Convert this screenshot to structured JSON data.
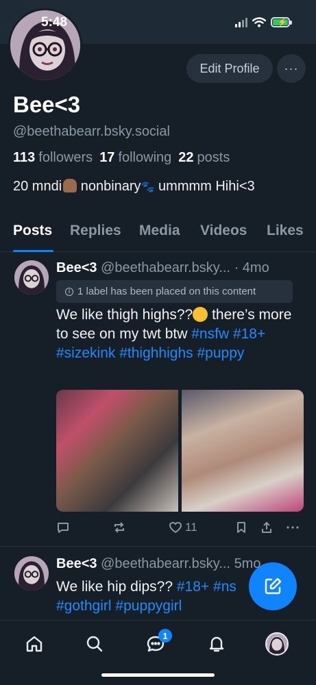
{
  "status_bar": {
    "time": "5:48"
  },
  "profile": {
    "display_name": "Bee<3",
    "handle": "@beethabearr.bsky.social",
    "edit_label": "Edit Profile",
    "more_label": "···",
    "stats": {
      "followers_count": "113",
      "followers_label": "followers",
      "following_count": "17",
      "following_label": "following",
      "posts_count": "22",
      "posts_label": "posts"
    },
    "bio_part1": "20 mndi",
    "bio_part2": " nonbinary",
    "bio_part3": " ummmm Hihi<3"
  },
  "tabs": [
    {
      "label": "Posts",
      "active": true
    },
    {
      "label": "Replies"
    },
    {
      "label": "Media"
    },
    {
      "label": "Videos"
    },
    {
      "label": "Likes"
    }
  ],
  "posts": [
    {
      "author": "Bee<3",
      "handle": "@beethabearr.bsky...",
      "time": "· 4mo",
      "label_notice": "1 label has been placed on this content",
      "text_1": "We like thigh highs??",
      "text_2": " there’s more to see on my twt btw ",
      "tags": [
        "#nsfw",
        "#18+",
        "#sizekink",
        "#thighhighs",
        "#puppy"
      ],
      "like_count": "11"
    },
    {
      "author": "Bee<3",
      "handle": "@beethabearr.bsky...",
      "time": "5mo",
      "text_1": "We like hip dips?? ",
      "tags": [
        "#18+",
        "#ns",
        "#gothgirl",
        "#puppygirl"
      ]
    }
  ],
  "colors": {
    "accent": "#1083fe",
    "background": "#161e27",
    "muted": "#8b98a5"
  },
  "nav": {
    "messages_badge": "1"
  }
}
